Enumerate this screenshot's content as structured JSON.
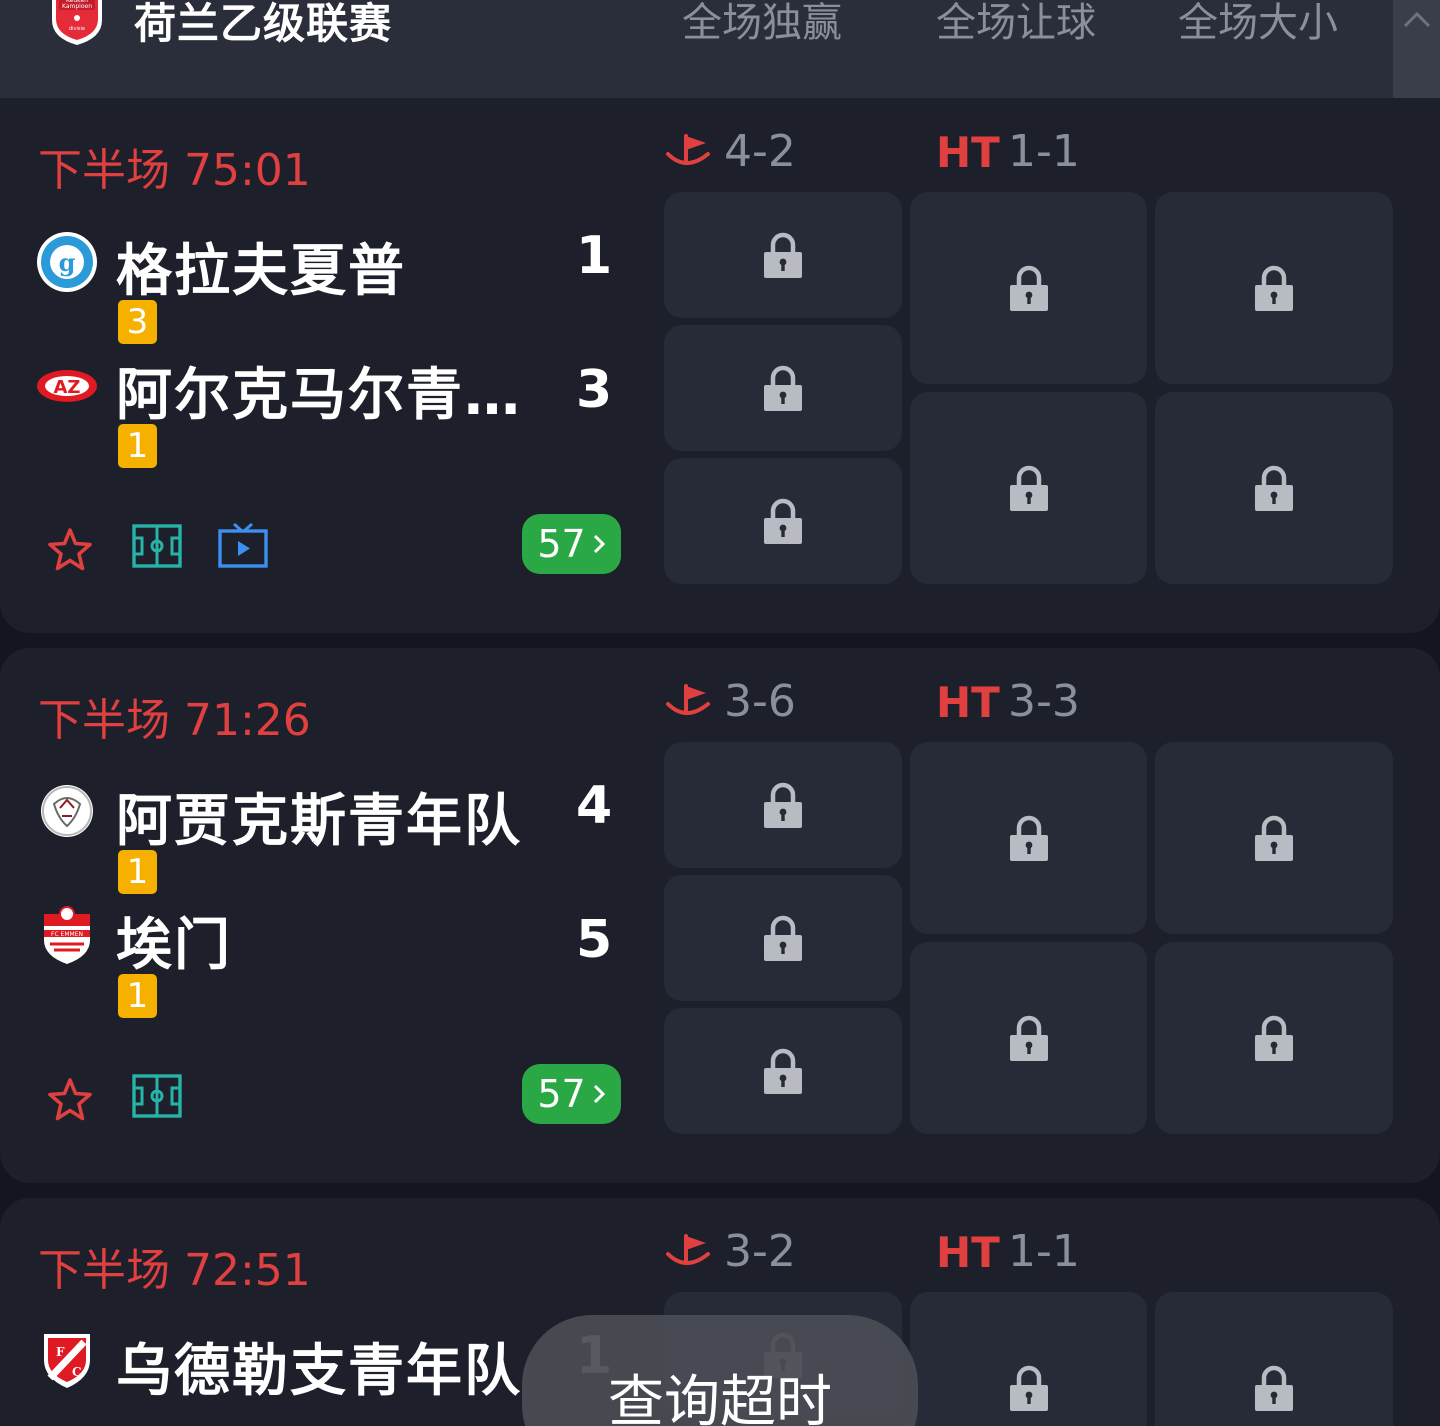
{
  "header": {
    "league_title": "荷兰乙级联赛",
    "league_logo_text": "Keuken Kampioen divisie",
    "columns": [
      "全场独赢",
      "全场让球",
      "全场大小"
    ],
    "collapse_icon": "chevron-up-icon"
  },
  "matches": [
    {
      "time": "下半场 75:01",
      "corners": "4-2",
      "ht_label": "HT",
      "ht_score": "1-1",
      "home": {
        "name": "格拉夫夏普",
        "score": "1",
        "card": "3"
      },
      "away": {
        "name": "阿尔克马尔青…",
        "score": "3",
        "card": "1"
      },
      "more_count": "57",
      "has_tv": true
    },
    {
      "time": "下半场 71:26",
      "corners": "3-6",
      "ht_label": "HT",
      "ht_score": "3-3",
      "home": {
        "name": "阿贾克斯青年队",
        "score": "4",
        "card": "1"
      },
      "away": {
        "name": "埃门",
        "score": "5",
        "card": "1"
      },
      "more_count": "57",
      "has_tv": false
    },
    {
      "time": "下半场 72:51",
      "corners": "3-2",
      "ht_label": "HT",
      "ht_score": "1-1",
      "home": {
        "name": "乌德勒支青年队",
        "score": "1"
      }
    }
  ],
  "toast": "查询超时",
  "colors": {
    "accent_red": "#e0403f",
    "card_yellow": "#f5b000",
    "more_green": "#2aa845",
    "field_teal": "#27b3a8",
    "tv_blue": "#3d8ff0"
  }
}
